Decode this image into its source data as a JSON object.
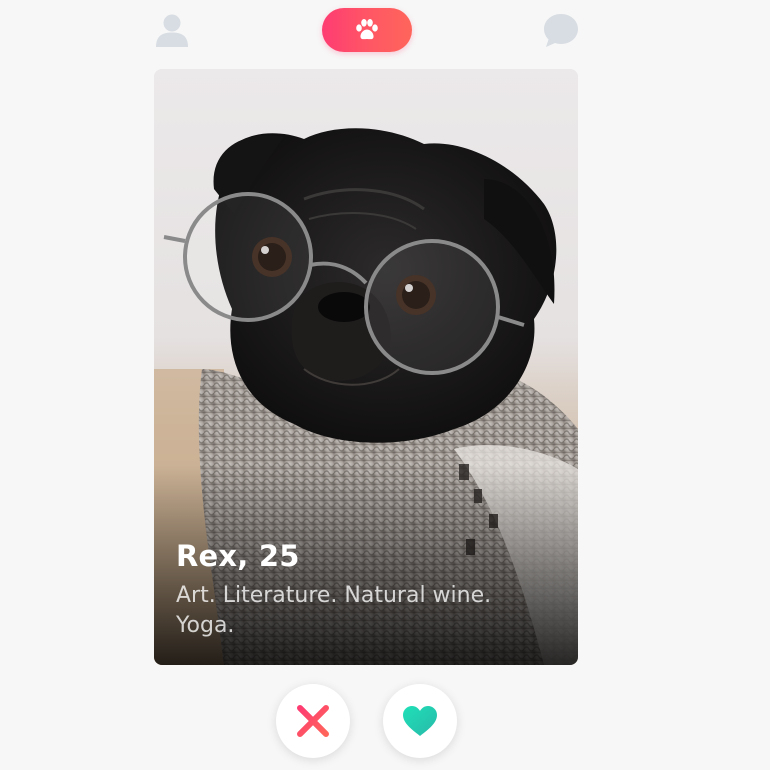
{
  "header": {
    "icons": {
      "profile": "user-icon",
      "center": "paw-icon",
      "messages": "chat-icon"
    },
    "accent_gradient": [
      "#fe3c72",
      "#ff655b"
    ]
  },
  "card": {
    "name_age": "Rex, 25",
    "bio": "Art. Literature. Natural wine. Yoga.",
    "photo_subject": "pug wearing round glasses and knitted scarf"
  },
  "actions": {
    "nope_icon": "x-icon",
    "like_icon": "heart-icon",
    "nope_color": "#fe3c72",
    "like_color": "#28d7b0"
  }
}
